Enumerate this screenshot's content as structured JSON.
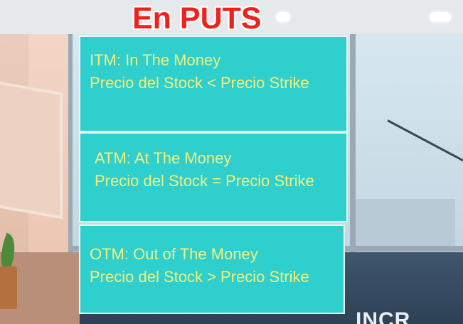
{
  "title": "En PUTS",
  "cards": [
    {
      "heading": "ITM: In The Money",
      "condition": "Precio del Stock < Precio Strike"
    },
    {
      "heading": "ATM: At The Money",
      "condition": "Precio del Stock = Precio Strike"
    },
    {
      "heading": "OTM: Out of The Money",
      "condition": "Precio del Stock > Precio Strike"
    }
  ],
  "watermark": "INCR",
  "colors": {
    "title": "#f0211c",
    "card_background": "#2ecfcd",
    "card_text": "#f4f07c"
  }
}
